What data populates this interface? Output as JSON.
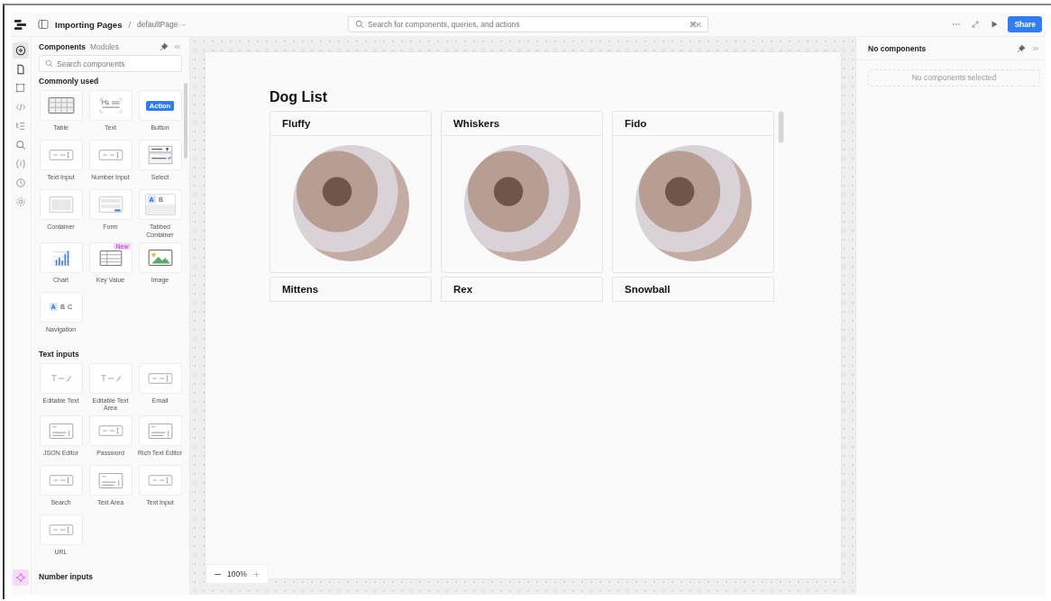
{
  "header": {
    "project": "Importing Pages",
    "separator": "/",
    "page": "defaultPage",
    "search": {
      "placeholder": "Search for components, queries, and actions",
      "shortcut": "⌘K"
    },
    "share": "Share"
  },
  "rail": [
    {
      "kind": "add",
      "selected": true
    },
    {
      "kind": "pages",
      "selected": false
    },
    {
      "kind": "select",
      "selected": false
    },
    {
      "kind": "code",
      "selected": false
    },
    {
      "kind": "tree",
      "selected": false
    },
    {
      "kind": "search",
      "selected": false
    },
    {
      "kind": "state",
      "selected": false
    },
    {
      "kind": "history",
      "selected": false
    },
    {
      "kind": "settings",
      "selected": false
    }
  ],
  "left_panel": {
    "tabs": [
      {
        "label": "Components",
        "selected": true
      },
      {
        "label": "Modules",
        "selected": false
      }
    ],
    "search": {
      "placeholder": "Search components"
    },
    "sections": [
      {
        "title": "Commonly used",
        "items": [
          {
            "label": "Table",
            "kind": "table"
          },
          {
            "label": "Text",
            "kind": "markdown"
          },
          {
            "label": "Button",
            "kind": "button",
            "badge": "Action"
          },
          {
            "label": "Text Input",
            "kind": "input"
          },
          {
            "label": "Number Input",
            "kind": "input"
          },
          {
            "label": "Select",
            "kind": "select"
          },
          {
            "label": "Container",
            "kind": "container"
          },
          {
            "label": "Form",
            "kind": "form"
          },
          {
            "label": "Tabbed Container",
            "kind": "tabs",
            "letters": [
              "A",
              "B"
            ]
          },
          {
            "label": "Chart",
            "kind": "chart"
          },
          {
            "label": "Key Value",
            "kind": "keyvalue",
            "badge": "New"
          },
          {
            "label": "Image",
            "kind": "image"
          },
          {
            "label": "Navigation",
            "kind": "nav",
            "letters": [
              "A",
              "B",
              "C"
            ]
          }
        ]
      },
      {
        "title": "Text inputs",
        "items": [
          {
            "label": "Editable Text",
            "kind": "editable"
          },
          {
            "label": "Editable Text Area",
            "kind": "editable"
          },
          {
            "label": "Email",
            "kind": "input"
          },
          {
            "label": "JSON Editor",
            "kind": "editor"
          },
          {
            "label": "Password",
            "kind": "input"
          },
          {
            "label": "Rich Text Editor",
            "kind": "editor"
          },
          {
            "label": "Search",
            "kind": "input"
          },
          {
            "label": "Text Area",
            "kind": "editor"
          },
          {
            "label": "Text Input",
            "kind": "input"
          },
          {
            "label": "URL",
            "kind": "input"
          }
        ]
      },
      {
        "title": "Number inputs"
      }
    ]
  },
  "canvas": {
    "title": "Dog List",
    "dogs": [
      {
        "name": "Fluffy"
      },
      {
        "name": "Whiskers"
      },
      {
        "name": "Fido"
      },
      {
        "name": "Mittens"
      },
      {
        "name": "Rex"
      },
      {
        "name": "Snowball"
      }
    ],
    "zoom": "100%"
  },
  "right_panel": {
    "title": "No components",
    "empty": "No components selected"
  }
}
